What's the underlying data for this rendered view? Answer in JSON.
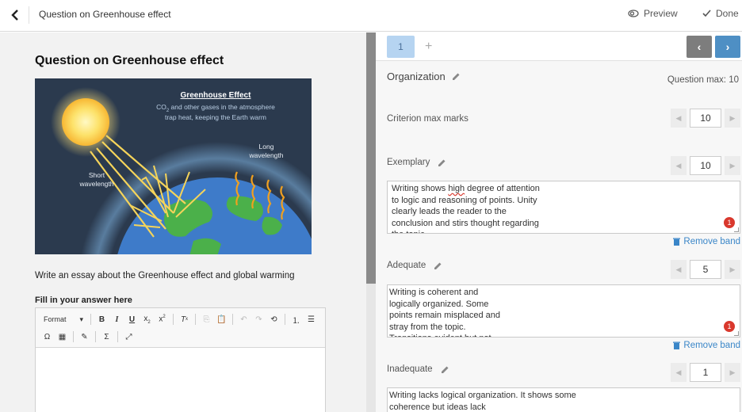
{
  "topbar": {
    "title": "Question on Greenhouse effect",
    "preview_label": "Preview",
    "done_label": "Done"
  },
  "left": {
    "question_title": "Question on Greenhouse effect",
    "illustration": {
      "title": "Greenhouse Effect",
      "caption_line1_pre": "CO",
      "caption_line1_sub": "2",
      "caption_line1_post": " and other gases in the atmosphere",
      "caption_line2": "trap heat, keeping the Earth warm",
      "short_wave_line1": "Short",
      "short_wave_line2": "wavelength",
      "long_wave_line1": "Long",
      "long_wave_line2": "wavelength"
    },
    "prompt": "Write an essay about the Greenhouse effect and global warming",
    "answer_label": "Fill in your answer here",
    "editor": {
      "format_label": "Format"
    }
  },
  "right": {
    "tabs": [
      {
        "label": "1"
      }
    ],
    "add_tab_icon": "plus-icon",
    "criterion": {
      "name": "Organization",
      "question_max_label": "Question max: 10",
      "criterion_max_label": "Criterion max marks",
      "criterion_max_value": "10"
    },
    "bands": [
      {
        "name": "Exemplary",
        "marks": "10",
        "text_pre": "Writing shows ",
        "text_misspelled": "high",
        "text_post": " degree of attention\nto logic and reasoning of points. Unity\nclearly leads the reader to the\nconclusion and stirs thought regarding\nthe topic.",
        "badge": "1",
        "remove_label": "Remove band"
      },
      {
        "name": "Adequate",
        "marks": "5",
        "text": "Writing is coherent and\nlogically organized. Some\npoints remain misplaced and\nstray from the topic.\nTransitions evident but not",
        "badge": "1",
        "remove_label": "Remove band"
      },
      {
        "name": "Inadequate",
        "marks": "1",
        "text": "Writing lacks logical organization. It shows some\ncoherence but ideas lack"
      }
    ]
  },
  "colors": {
    "tab_active": "#b6d4f1",
    "nav_next": "#4e8fc4",
    "nav_prev": "#7d7d7d",
    "link": "#3a86c8",
    "badge": "#d9382d"
  }
}
